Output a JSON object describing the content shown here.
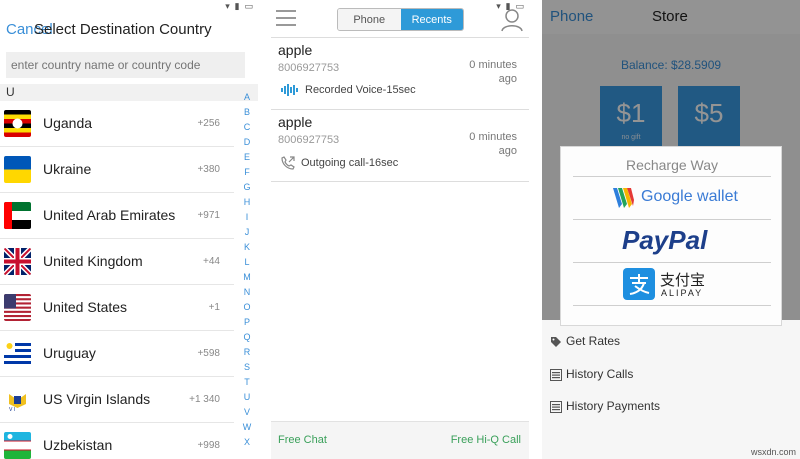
{
  "screen1": {
    "cancel_label": "Cancel",
    "title": "Select Destination Country",
    "search_placeholder": "enter country name or country code",
    "section_letter": "U",
    "countries": [
      {
        "name": "Uganda",
        "code": "+256"
      },
      {
        "name": "Ukraine",
        "code": "+380"
      },
      {
        "name": "United Arab Emirates",
        "code": "+971"
      },
      {
        "name": "United Kingdom",
        "code": "+44"
      },
      {
        "name": "United States",
        "code": "+1"
      },
      {
        "name": "Uruguay",
        "code": "+598"
      },
      {
        "name": "US Virgin Islands",
        "code": "+1 340"
      },
      {
        "name": "Uzbekistan",
        "code": "+998"
      }
    ],
    "alphabet": [
      "A",
      "B",
      "C",
      "D",
      "E",
      "F",
      "G",
      "H",
      "I",
      "J",
      "K",
      "L",
      "M",
      "N",
      "O",
      "P",
      "Q",
      "R",
      "S",
      "T",
      "U",
      "V",
      "W",
      "X"
    ]
  },
  "screen2": {
    "tabs": [
      {
        "label": "Phone",
        "active": false
      },
      {
        "label": "Recents",
        "active": true
      }
    ],
    "recents": [
      {
        "name": "apple",
        "number": "8006927753",
        "time_line1": "0 minutes",
        "time_line2": "ago",
        "kind": "Recorded Voice-15sec",
        "icon": "voice-wave-icon"
      },
      {
        "name": "apple",
        "number": "8006927753",
        "time_line1": "0 minutes",
        "time_line2": "ago",
        "kind": "Outgoing call-16sec",
        "icon": "outgoing-call-icon"
      }
    ],
    "footer_left": "Free Chat",
    "footer_right": "Free Hi-Q Call"
  },
  "screen3": {
    "back_label": "Phone",
    "title": "Store",
    "balance": "Balance: $28.5909",
    "tiles": [
      {
        "amount": "$1",
        "sub": "no gift"
      },
      {
        "amount": "$5",
        "sub": ""
      }
    ],
    "menu": [
      {
        "label": "Get Rates",
        "icon": "tag-icon"
      },
      {
        "label": "History Calls",
        "icon": "list-icon"
      },
      {
        "label": "History Payments",
        "icon": "list-icon"
      }
    ],
    "dialog": {
      "title": "Recharge Way",
      "options": [
        "Google wallet",
        "PayPal",
        "支付宝",
        "ALIPAY"
      ]
    }
  },
  "watermark": "wsxdn.com",
  "colors": {
    "accent": "#3a8fd8",
    "green": "#3aa05a",
    "tile": "#3a9ae2",
    "paypal_dark": "#1d3f8a",
    "paypal_light": "#1e8ad1",
    "alipay": "#1e8fe0"
  }
}
